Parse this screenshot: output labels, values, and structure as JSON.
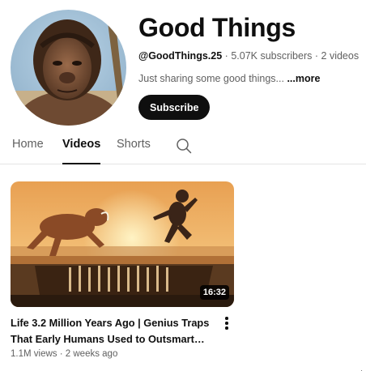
{
  "channel": {
    "title": "Good Things",
    "handle": "@GoodThings.25",
    "separator": "·",
    "subscribers": "5.07K subscribers",
    "videos_count": "2 videos",
    "description": "Just sharing some good things...",
    "more_label": "...more",
    "subscribe_label": "Subscribe"
  },
  "tabs": [
    {
      "label": "Home",
      "active": false
    },
    {
      "label": "Videos",
      "active": true
    },
    {
      "label": "Shorts",
      "active": false
    }
  ],
  "icons": {
    "search": "search-icon",
    "more": "more-vert-icon"
  },
  "videos": [
    {
      "title": "Life 3.2 Million Years Ago | Genius Traps That Early Humans Used to Outsmart…",
      "duration": "16:32",
      "views": "1.1M views",
      "age": "2 weeks ago"
    }
  ],
  "colors": {
    "text_primary": "#0f0f0f",
    "text_secondary": "#606060",
    "subscribe_bg": "#0f0f0f",
    "divider": "#e5e5e5"
  }
}
